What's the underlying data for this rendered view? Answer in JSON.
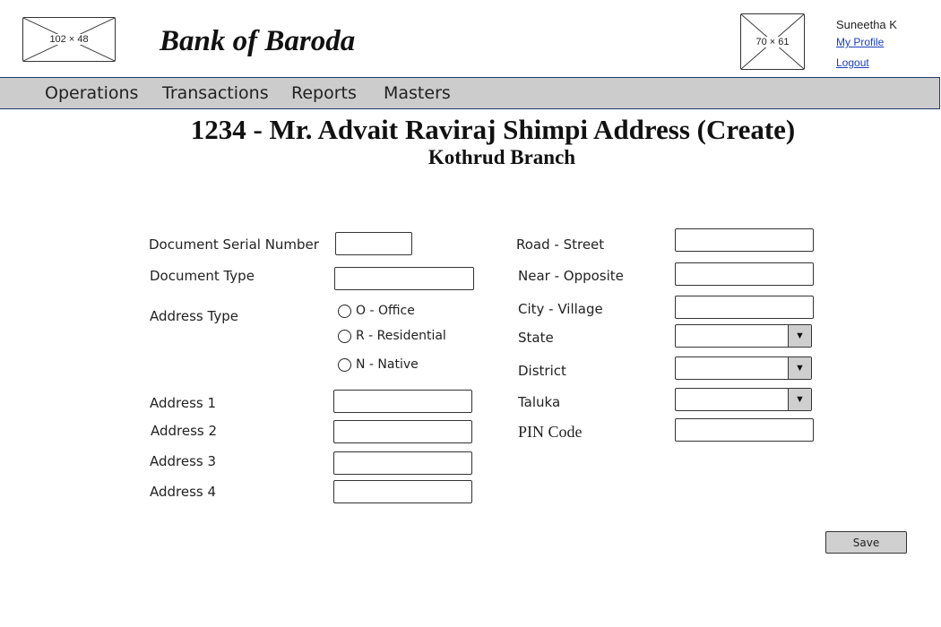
{
  "header": {
    "logo_placeholder": "102 × 48",
    "bank_name": "Bank of Baroda",
    "avatar_placeholder": "70 × 61",
    "user_name": "Suneetha K",
    "my_profile": "My Profile",
    "logout": "Logout"
  },
  "nav": {
    "items": [
      "Operations",
      "Transactions",
      "Reports",
      "Masters"
    ]
  },
  "page": {
    "title": "1234 - Mr. Advait Raviraj Shimpi Address (Create)",
    "subtitle": "Kothrud Branch"
  },
  "form": {
    "document_serial_number": {
      "label": "Document Serial Number",
      "value": ""
    },
    "document_type": {
      "label": "Document Type",
      "value": ""
    },
    "address_type": {
      "label": "Address Type",
      "options": [
        "O - Office",
        "R - Residential",
        "N - Native"
      ]
    },
    "address1": {
      "label": "Address 1",
      "value": ""
    },
    "address2": {
      "label": "Address 2",
      "value": ""
    },
    "address3": {
      "label": "Address 3",
      "value": ""
    },
    "address4": {
      "label": "Address 4",
      "value": ""
    },
    "road_street": {
      "label": "Road - Street",
      "value": ""
    },
    "near_opposite": {
      "label": "Near - Opposite",
      "value": ""
    },
    "city_village": {
      "label": "City - Village",
      "value": ""
    },
    "state": {
      "label": "State",
      "value": ""
    },
    "district": {
      "label": "District",
      "value": ""
    },
    "taluka": {
      "label": "Taluka",
      "value": ""
    },
    "pin_code": {
      "label": "PIN Code",
      "value": ""
    },
    "save_label": "Save"
  },
  "icons": {
    "dropdown_arrow": "▼"
  }
}
